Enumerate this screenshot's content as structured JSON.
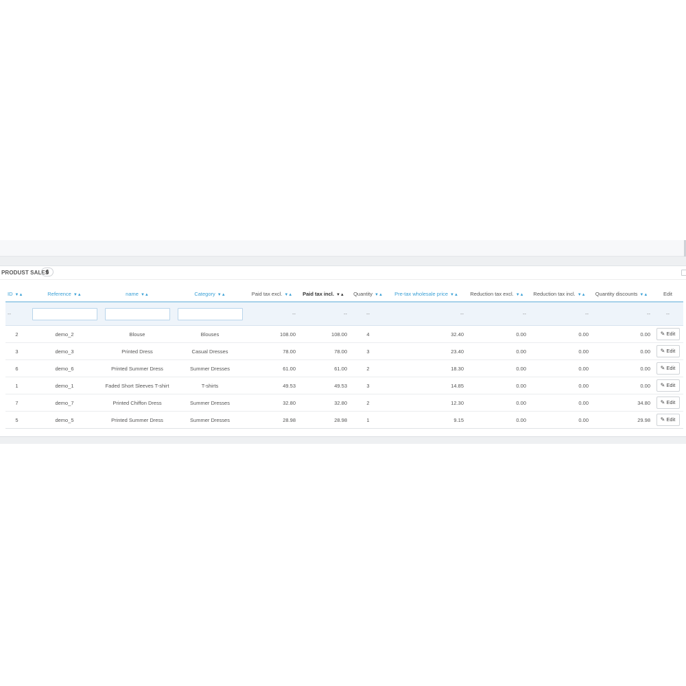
{
  "panel": {
    "title": "PRODUST SALES",
    "count": "6"
  },
  "columns": [
    {
      "key": "id",
      "label": "ID",
      "sortable": true,
      "style": "link"
    },
    {
      "key": "reference",
      "label": "Reference",
      "sortable": true,
      "style": "link"
    },
    {
      "key": "name",
      "label": "name",
      "sortable": true,
      "style": "link"
    },
    {
      "key": "category",
      "label": "Category",
      "sortable": true,
      "style": "link"
    },
    {
      "key": "paid_tax_excl",
      "label": "Paid tax excl.",
      "sortable": true,
      "style": "plain"
    },
    {
      "key": "paid_tax_incl",
      "label": "Paid tax incl.",
      "sortable": true,
      "style": "active"
    },
    {
      "key": "quantity",
      "label": "Quantity",
      "sortable": true,
      "style": "plain"
    },
    {
      "key": "pretax_wholesale",
      "label": "Pre-tax wholesale price",
      "sortable": true,
      "style": "link"
    },
    {
      "key": "reduction_tax_excl",
      "label": "Reduction tax excl.",
      "sortable": true,
      "style": "plain"
    },
    {
      "key": "reduction_tax_incl",
      "label": "Reduction tax incl.",
      "sortable": true,
      "style": "plain"
    },
    {
      "key": "quantity_discounts",
      "label": "Quantity discounts",
      "sortable": true,
      "style": "plain"
    },
    {
      "key": "edit",
      "label": "Edit",
      "sortable": false,
      "style": "plain"
    }
  ],
  "sort_arrows": {
    "down": "▼",
    "up": "▲"
  },
  "filter": {
    "placeholder": "--"
  },
  "rows": [
    {
      "id": "2",
      "reference": "demo_2",
      "name": "Blouse",
      "category": "Blouses",
      "paid_tax_excl": "108.00",
      "paid_tax_incl": "108.00",
      "quantity": "4",
      "pretax_wholesale": "32.40",
      "reduction_tax_excl": "0.00",
      "reduction_tax_incl": "0.00",
      "quantity_discounts": "0.00",
      "edit": "Edit"
    },
    {
      "id": "3",
      "reference": "demo_3",
      "name": "Printed Dress",
      "category": "Casual Dresses",
      "paid_tax_excl": "78.00",
      "paid_tax_incl": "78.00",
      "quantity": "3",
      "pretax_wholesale": "23.40",
      "reduction_tax_excl": "0.00",
      "reduction_tax_incl": "0.00",
      "quantity_discounts": "0.00",
      "edit": "Edit"
    },
    {
      "id": "6",
      "reference": "demo_6",
      "name": "Printed Summer Dress",
      "category": "Summer Dresses",
      "paid_tax_excl": "61.00",
      "paid_tax_incl": "61.00",
      "quantity": "2",
      "pretax_wholesale": "18.30",
      "reduction_tax_excl": "0.00",
      "reduction_tax_incl": "0.00",
      "quantity_discounts": "0.00",
      "edit": "Edit"
    },
    {
      "id": "1",
      "reference": "demo_1",
      "name": "Faded Short Sleeves T-shirt",
      "category": "T-shirts",
      "paid_tax_excl": "49.53",
      "paid_tax_incl": "49.53",
      "quantity": "3",
      "pretax_wholesale": "14.85",
      "reduction_tax_excl": "0.00",
      "reduction_tax_incl": "0.00",
      "quantity_discounts": "0.00",
      "edit": "Edit"
    },
    {
      "id": "7",
      "reference": "demo_7",
      "name": "Printed Chiffon Dress",
      "category": "Summer Dresses",
      "paid_tax_excl": "32.80",
      "paid_tax_incl": "32.80",
      "quantity": "2",
      "pretax_wholesale": "12.30",
      "reduction_tax_excl": "0.00",
      "reduction_tax_incl": "0.00",
      "quantity_discounts": "34.80",
      "edit": "Edit"
    },
    {
      "id": "5",
      "reference": "demo_5",
      "name": "Printed Summer Dress",
      "category": "Summer Dresses",
      "paid_tax_excl": "28.98",
      "paid_tax_incl": "28.98",
      "quantity": "1",
      "pretax_wholesale": "9.15",
      "reduction_tax_excl": "0.00",
      "reduction_tax_incl": "0.00",
      "quantity_discounts": "29.98",
      "edit": "Edit"
    }
  ],
  "colors": {
    "link": "#3aa0d6",
    "filter_bg": "#eef4fa",
    "filter_border": "#a6d1ea",
    "text": "#555555"
  },
  "icons": {
    "edit": "pencil-icon",
    "expand": "expand-icon"
  }
}
